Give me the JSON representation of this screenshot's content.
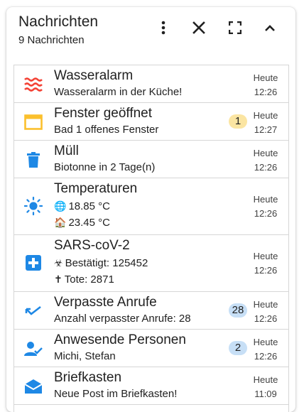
{
  "header": {
    "title": "Nachrichten",
    "subtitle": "9 Nachrichten",
    "menu_icon": "more-vert-icon",
    "close_icon": "close-icon",
    "fullscreen_icon": "fullscreen-icon",
    "collapse_icon": "chevron-up-icon"
  },
  "colors": {
    "water": "#f44336",
    "window": "#fbc02d",
    "blue": "#1e88e5",
    "sun": "#1e88e5"
  },
  "messages": [
    {
      "title": "Wasseralarm",
      "text": "Wasseralarm in der Küche!",
      "day": "Heute",
      "time": "12:26",
      "icon": "water-waves-icon"
    },
    {
      "title": "Fenster geöffnet",
      "text": "Bad 1 offenes Fenster",
      "day": "Heute",
      "time": "12:27",
      "badge": "1",
      "icon": "window-icon"
    },
    {
      "title": "Müll",
      "text": "Biotonne in 2 Tage(n)",
      "day": "Heute",
      "time": "12:26",
      "icon": "trash-icon"
    },
    {
      "title": "Temperaturen",
      "line1_emoji": "🌐",
      "line1": "18.85 °C",
      "line2_emoji": "🏠",
      "line2": "23.45 °C",
      "day": "Heute",
      "time": "12:26",
      "icon": "sun-icon"
    },
    {
      "title": "SARS-coV-2",
      "line1_emoji": "☣",
      "line1": "Bestätigt: 125452",
      "line2_emoji": "✝",
      "line2": "Tote: 2871",
      "day": "Heute",
      "time": "12:26",
      "icon": "medical-cross-icon"
    },
    {
      "title": "Verpasste Anrufe",
      "text": "Anzahl verpasster Anrufe: 28",
      "day": "Heute",
      "time": "12:26",
      "badge": "28",
      "icon": "missed-call-icon"
    },
    {
      "title": "Anwesende Personen",
      "text": "Michi, Stefan",
      "day": "Heute",
      "time": "12:26",
      "badge": "2",
      "icon": "person-check-icon"
    },
    {
      "title": "Briefkasten",
      "text": "Neue Post im Briefkasten!",
      "day": "Heute",
      "time": "11:09",
      "icon": "mail-open-icon"
    }
  ]
}
